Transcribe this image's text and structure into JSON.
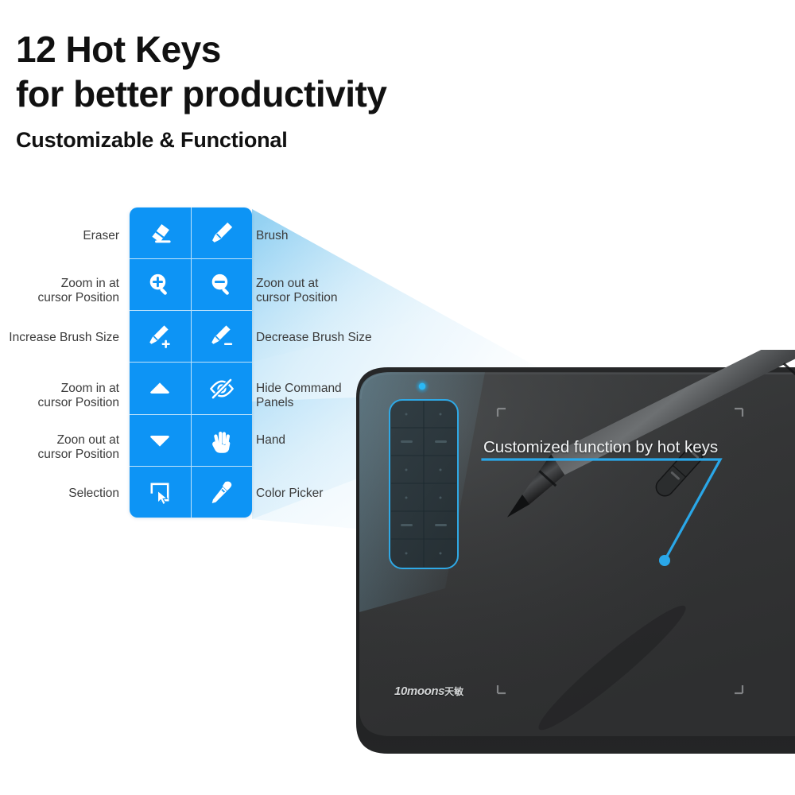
{
  "headline": {
    "line1": "12 Hot Keys",
    "line2": "for better productivity",
    "subtitle": "Customizable & Functional"
  },
  "hotkey_grid": {
    "columns": 2,
    "rows": 6,
    "key_color": "#0d94f5",
    "icon_color": "#ffffff",
    "keys": [
      {
        "position": "row1-left",
        "icon": "eraser-icon",
        "label": "Eraser",
        "label_side": "left"
      },
      {
        "position": "row1-right",
        "icon": "brush-icon",
        "label": "Brush",
        "label_side": "right"
      },
      {
        "position": "row2-left",
        "icon": "zoom-in-icon",
        "label": "Zoom in at\ncursor Position",
        "label_side": "left"
      },
      {
        "position": "row2-right",
        "icon": "zoom-out-icon",
        "label": "Zoon out at\ncursor Position",
        "label_side": "right"
      },
      {
        "position": "row3-left",
        "icon": "brush-plus-icon",
        "label": "Increase Brush Size",
        "label_side": "left"
      },
      {
        "position": "row3-right",
        "icon": "brush-minus-icon",
        "label": "Decrease Brush Size",
        "label_side": "right"
      },
      {
        "position": "row4-left",
        "icon": "triangle-up-icon",
        "label": "Zoom in at\ncursor Position",
        "label_side": "left"
      },
      {
        "position": "row4-right",
        "icon": "eye-slash-icon",
        "label": "Hide Command\nPanels",
        "label_side": "right"
      },
      {
        "position": "row5-left",
        "icon": "triangle-down-icon",
        "label": "Zoon out at\ncursor Position",
        "label_side": "left"
      },
      {
        "position": "row5-right",
        "icon": "hand-icon",
        "label": "Hand",
        "label_side": "right"
      },
      {
        "position": "row6-left",
        "icon": "selection-cursor-icon",
        "label": "Selection",
        "label_side": "left"
      },
      {
        "position": "row6-right",
        "icon": "color-picker-icon",
        "label": "Color Picker",
        "label_side": "right"
      }
    ]
  },
  "labels": {
    "l1": "Eraser",
    "l2a": "Zoom in at",
    "l2b": "cursor Position",
    "l3": "Increase Brush Size",
    "l4a": "Zoom in at",
    "l4b": "cursor Position",
    "l5a": "Zoon out at",
    "l5b": "cursor Position",
    "l6": "Selection",
    "r1": "Brush",
    "r2a": "Zoon out at",
    "r2b": "cursor Position",
    "r3": "Decrease Brush Size",
    "r4a": "Hide Command",
    "r4b": "Panels",
    "r5": "Hand",
    "r6": "Color Picker"
  },
  "product": {
    "caption": "Customized function by hot keys",
    "brand": "10moons",
    "brand_cn": "天敏",
    "body_color": "#343434",
    "accent_color": "#2aa7e8",
    "led_color": "#25b5f0",
    "panel_rows": 6,
    "panel_columns": 2
  }
}
